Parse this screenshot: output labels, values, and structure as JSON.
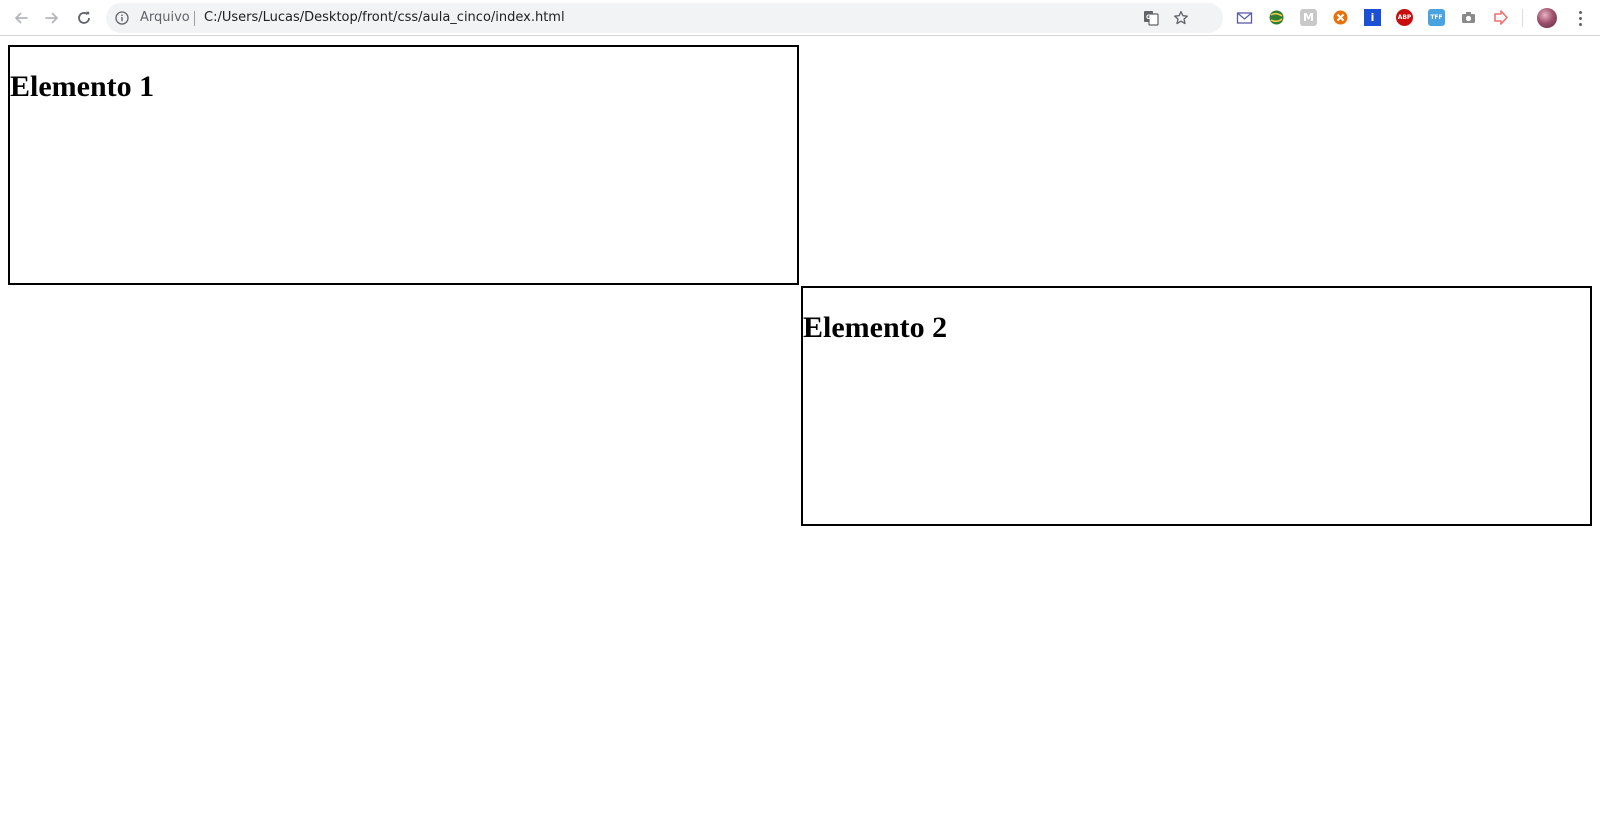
{
  "browser": {
    "scheme_label": "Arquivo",
    "url": "C:/Users/Lucas/Desktop/front/css/aula_cinco/index.html",
    "extensions": [
      {
        "name": "ext-envelope-icon",
        "color": "#5a5aa8",
        "text": ""
      },
      {
        "name": "ext-globe-icon",
        "color": "#2e7d32",
        "text": ""
      },
      {
        "name": "ext-m-icon",
        "color": "#c8c8c8",
        "text": "M"
      },
      {
        "name": "ext-orange-circle-icon",
        "color": "#e8710a",
        "text": ""
      },
      {
        "name": "ext-info-icon",
        "color": "#1a4fd6",
        "text": "i"
      },
      {
        "name": "ext-abp-icon",
        "color": "#c70d0d",
        "text": "ABP"
      },
      {
        "name": "ext-tff-icon",
        "color": "#4aa3df",
        "text": "TFF"
      },
      {
        "name": "ext-camera-icon",
        "color": "#8a8a8a",
        "text": ""
      },
      {
        "name": "ext-arrow-icon",
        "color": "#f07070",
        "text": ""
      }
    ]
  },
  "page": {
    "element_1": "Elemento 1",
    "element_2": "Elemento 2"
  }
}
